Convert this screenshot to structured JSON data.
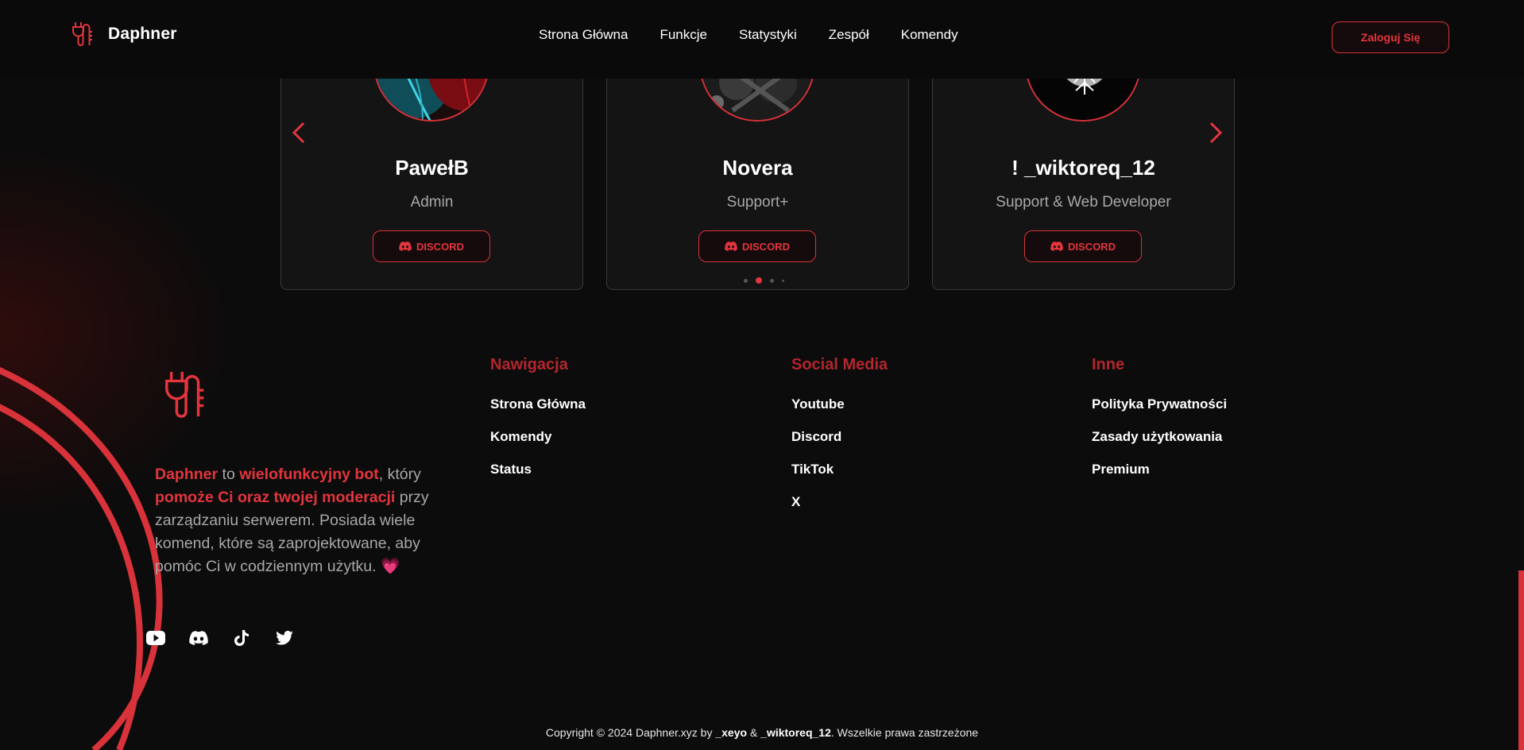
{
  "header": {
    "brand": "Daphner",
    "nav": [
      "Strona Główna",
      "Funkcje",
      "Statystyki",
      "Zespół",
      "Komendy"
    ],
    "login_label": "Zaloguj Się"
  },
  "team": {
    "cards": [
      {
        "name": "PawełB",
        "role": "Admin",
        "button": "DISCORD"
      },
      {
        "name": "Novera",
        "role": "Support+",
        "button": "DISCORD"
      },
      {
        "name": "! _wiktoreq_12",
        "role": "Support & Web Developer",
        "button": "DISCORD"
      }
    ],
    "dots_active": 2,
    "dots_total": 4
  },
  "footer": {
    "desc": {
      "brand": "Daphner",
      "t1": " to ",
      "hl1": "wielofunkcyjny bot",
      "t2": ", który ",
      "hl2": "pomoże Ci oraz twojej moderacji",
      "t3": " przy zarządzaniu serwerem. Posiada wiele komend, które są zaprojektowane, aby pomóc Ci w codziennym użytku. ",
      "heart": "💗"
    },
    "socials": [
      "youtube-icon",
      "discord-icon",
      "tiktok-icon",
      "twitter-icon"
    ],
    "columns": [
      {
        "title": "Nawigacja",
        "items": [
          "Strona Główna",
          "Komendy",
          "Status"
        ]
      },
      {
        "title": "Social Media",
        "items": [
          "Youtube",
          "Discord",
          "TikTok",
          "X"
        ]
      },
      {
        "title": "Inne",
        "items": [
          "Polityka Prywatności",
          "Zasady użytkowania",
          "Premium"
        ]
      }
    ],
    "copyright": {
      "pre": "Copyright © 2024 Daphner.xyz by ",
      "a1": "_xeyo",
      "mid": " & ",
      "a2": "_wiktoreq_12",
      "post": ". Wszelkie prawa zastrzeżone"
    }
  },
  "colors": {
    "accent": "#e3353d",
    "background": "#0c0c0c",
    "muted_text": "#a8a8a8"
  }
}
